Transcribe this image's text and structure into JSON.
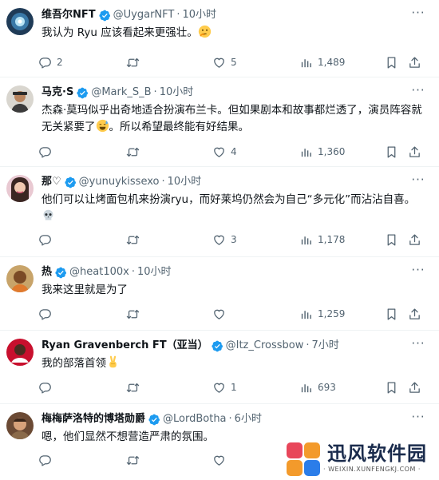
{
  "tweets": [
    {
      "name": "维吾尔NFT",
      "handle": "@UygarNFT",
      "time": "10小时",
      "text": "我认为 Ryu 应该看起来更强壮。",
      "emoji_icon": "thinking-face-emoji",
      "replies": "2",
      "retweets": "",
      "likes": "5",
      "views": "1,489"
    },
    {
      "name": "马克·S",
      "handle": "@Mark_S_B",
      "time": "10小时",
      "text": "杰森·莫玛似乎出奇地适合扮演布兰卡。但如果剧本和故事都烂透了，演员阵容就无关紧要了",
      "text_after": "。所以希望最终能有好结果。",
      "emoji_icon": "sweat-smile-emoji",
      "replies": "",
      "retweets": "",
      "likes": "4",
      "views": "1,360"
    },
    {
      "name": "那♡",
      "handle": "@yunuykissexo",
      "time": "10小时",
      "text": "他们可以让烤面包机来扮演ryu，而好莱坞仍然会为自己“多元化”而沾沾自喜。",
      "emoji_icon": "skull-emoji",
      "replies": "",
      "retweets": "",
      "likes": "3",
      "views": "1,178"
    },
    {
      "name": "热",
      "handle": "@heat100x",
      "time": "10小时",
      "text": "我来这里就是为了",
      "replies": "",
      "retweets": "",
      "likes": "",
      "views": "1,259"
    },
    {
      "name": "Ryan Gravenberch FT（亚当）",
      "handle": "@Itz_Crossbow",
      "time": "7小时",
      "text": "我的部落首领",
      "emoji_icon": "victory-hand-emoji",
      "replies": "",
      "retweets": "",
      "likes": "1",
      "views": "693"
    },
    {
      "name": "梅梅萨洛特的博塔勋爵",
      "handle": "@LordBotha",
      "time": "6小时",
      "text": "嗯，他们显然不想营造严肃的氛围。",
      "replies": "",
      "retweets": "",
      "likes": "",
      "views": ""
    }
  ],
  "separator": "·",
  "more_label": "···",
  "colors": {
    "verified": "#1d9bf0",
    "muted": "#536471",
    "text": "#0f1419",
    "border": "#eff3f4"
  },
  "watermark": {
    "title": "迅风软件园",
    "subtitle": "· WEIXIN.XUNFENGKJ.COM ·"
  }
}
